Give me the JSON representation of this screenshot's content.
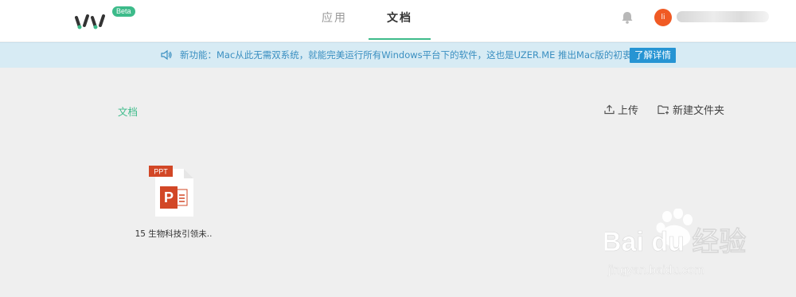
{
  "header": {
    "beta_badge": "Beta",
    "tabs": [
      {
        "label": "应用",
        "active": false
      },
      {
        "label": "文档",
        "active": true
      }
    ],
    "avatar_initial": "li",
    "accent_color": "#3dbb8a"
  },
  "notice": {
    "text": "新功能：Mac从此无需双系统，就能完美运行所有Windows平台下的软件，这也是UZER.ME 推出Mac版的初衷。",
    "button_label": "了解详情"
  },
  "toolbar": {
    "breadcrumb": "文档",
    "upload_label": "上传",
    "new_folder_label": "新建文件夹"
  },
  "files": [
    {
      "type_badge": "PPT",
      "name": "15 生物科技引领未.."
    }
  ],
  "watermark": {
    "brand": "Bai du 经验",
    "url": "jingyan.baidu.com"
  }
}
